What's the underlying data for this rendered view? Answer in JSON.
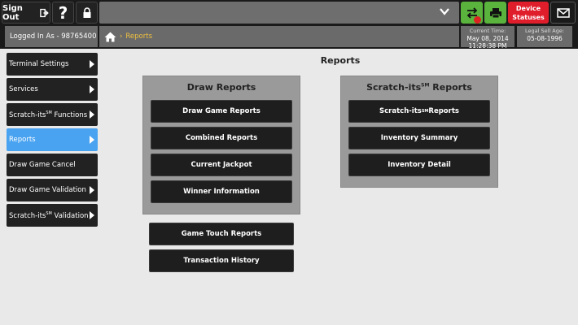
{
  "topbar": {
    "signout_label": "Sign Out",
    "help_label": "?",
    "device_label_1": "Device",
    "device_label_2": "Statuses",
    "colors": {
      "green": "#59b33c",
      "red": "#e01d2b",
      "active_blue": "#4aa3f0"
    }
  },
  "infobar": {
    "logged_in": "Logged In As - 98765400",
    "breadcrumb_sep": "›",
    "breadcrumb_label": "Reports",
    "time_label": "Current Time:",
    "time_date": "May 08, 2014",
    "time_time": "11:28:38 PM",
    "age_label": "Legal Sell Age:",
    "age_value": "05-08-1996"
  },
  "sidebar": {
    "items": [
      {
        "label": "Terminal Settings",
        "arrow": true
      },
      {
        "label": "Services",
        "arrow": true
      },
      {
        "label_pre": "Scratch-its",
        "sup": "SM",
        "label_post": " Functions",
        "arrow": true
      },
      {
        "label": "Reports",
        "arrow": true,
        "active": true
      },
      {
        "label": "Draw Game Cancel",
        "arrow": false
      },
      {
        "label": "Draw Game Validation",
        "arrow": true
      },
      {
        "label_pre": "Scratch-its",
        "sup": "SM",
        "label_post": " Validation",
        "arrow": true
      }
    ]
  },
  "main": {
    "title": "Reports",
    "draw_panel": {
      "title": "Draw Reports",
      "buttons": [
        "Draw Game Reports",
        "Combined Reports",
        "Current Jackpot",
        "Winner Information"
      ]
    },
    "scratch_panel": {
      "title_pre": "Scratch-its",
      "title_sup": "SM",
      "title_post": " Reports",
      "buttons_pre": "Scratch-its",
      "buttons_sup": "SM",
      "buttons_post": " Reports",
      "inventory_summary": "Inventory Summary",
      "inventory_detail": "Inventory Detail"
    },
    "extra_buttons": [
      "Game Touch Reports",
      "Transaction History"
    ]
  }
}
